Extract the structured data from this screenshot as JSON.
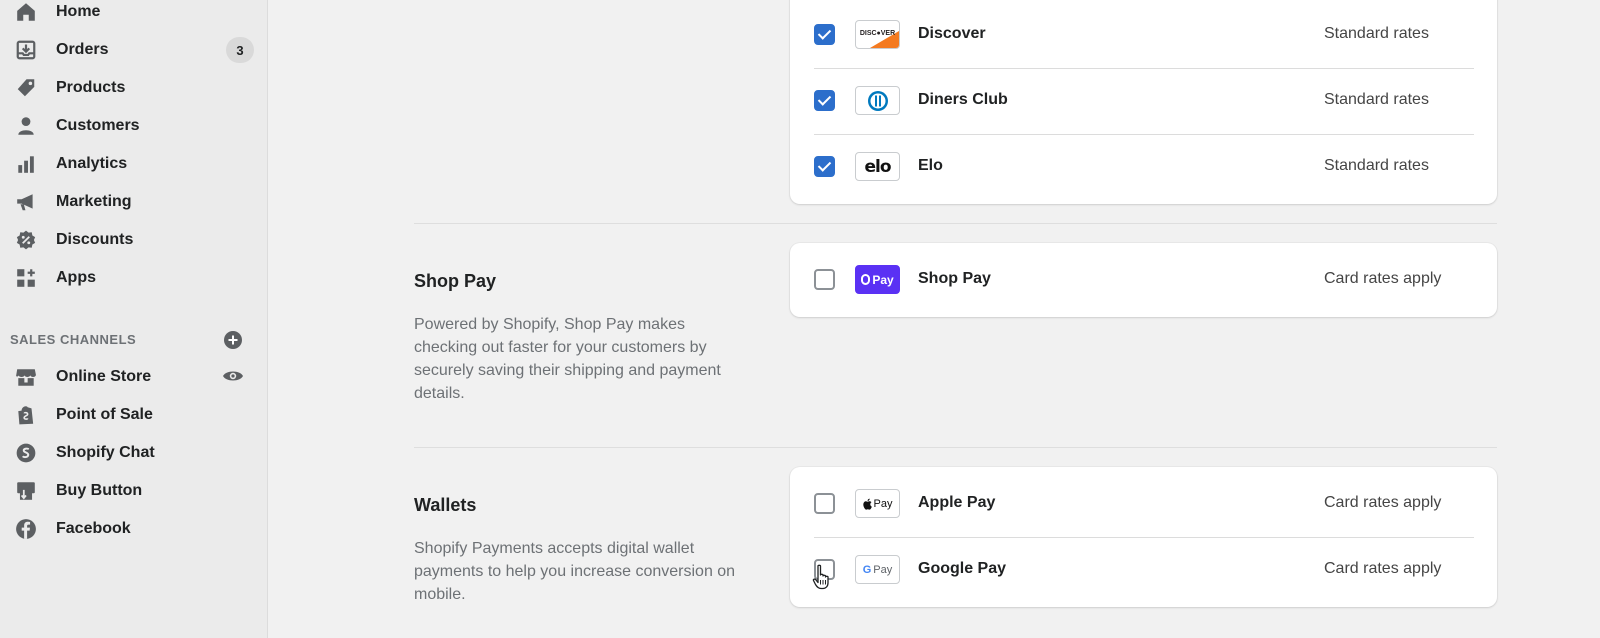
{
  "sidebar": {
    "nav": [
      {
        "label": "Home",
        "icon": "home-icon"
      },
      {
        "label": "Orders",
        "icon": "orders-icon",
        "badge": "3"
      },
      {
        "label": "Products",
        "icon": "tag-icon"
      },
      {
        "label": "Customers",
        "icon": "person-icon"
      },
      {
        "label": "Analytics",
        "icon": "bar-chart-icon"
      },
      {
        "label": "Marketing",
        "icon": "megaphone-icon"
      },
      {
        "label": "Discounts",
        "icon": "discount-icon"
      },
      {
        "label": "Apps",
        "icon": "apps-icon"
      }
    ],
    "sales_channels_title": "SALES CHANNELS",
    "channels": [
      {
        "label": "Online Store",
        "icon": "store-icon"
      },
      {
        "label": "Point of Sale",
        "icon": "shopping-bag-icon"
      },
      {
        "label": "Shopify Chat",
        "icon": "chat-icon"
      },
      {
        "label": "Buy Button",
        "icon": "buy-button-icon"
      },
      {
        "label": "Facebook",
        "icon": "facebook-icon"
      }
    ]
  },
  "cards_section": {
    "methods": [
      {
        "name": "Discover",
        "rate": "Standard rates",
        "checked": true,
        "logo_text": "DISC●VER"
      },
      {
        "name": "Diners Club",
        "rate": "Standard rates",
        "checked": true
      },
      {
        "name": "Elo",
        "rate": "Standard rates",
        "checked": true,
        "logo_text": "elo"
      }
    ]
  },
  "shop_pay": {
    "heading": "Shop Pay",
    "description": "Powered by Shopify, Shop Pay makes checking out faster for your customers by securely saving their shipping and payment details.",
    "method": {
      "name": "Shop Pay",
      "rate": "Card rates apply",
      "checked": false,
      "logo_text": "Pay"
    }
  },
  "wallets": {
    "heading": "Wallets",
    "description": "Shopify Payments accepts digital wallet payments to help you increase conversion on mobile.",
    "methods": [
      {
        "name": "Apple Pay",
        "rate": "Card rates apply",
        "checked": false,
        "logo_text": "Pay"
      },
      {
        "name": "Google Pay",
        "rate": "Card rates apply",
        "checked": false,
        "logo_text": "Pay"
      }
    ]
  },
  "colors": {
    "accent_blue": "#2c6ecb",
    "shop_pay_purple": "#5a31f4"
  }
}
